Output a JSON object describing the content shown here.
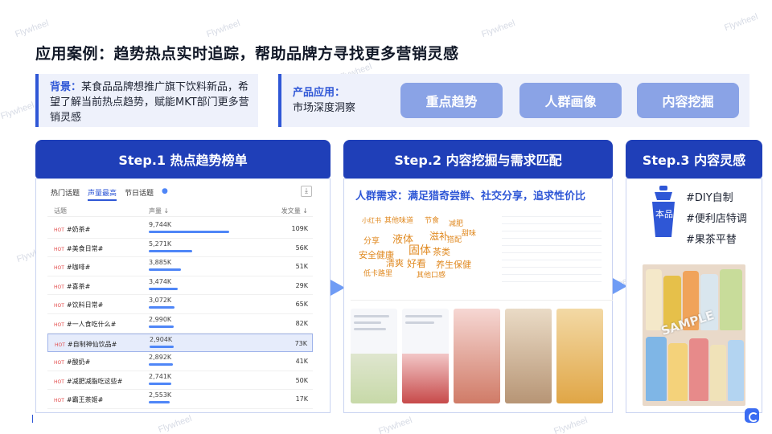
{
  "page": {
    "title": "应用案例：趋势热点实时追踪，帮助品牌方寻找更多营销灵感",
    "watermark": "Flywheel"
  },
  "background": {
    "label": "背景：",
    "text": "某食品品牌想推广旗下饮料新品，希望了解当前热点趋势，赋能MKT部门更多营销灵感"
  },
  "product": {
    "label": "产品应用：",
    "label2": "市场深度洞察",
    "pills": [
      "重点趋势",
      "人群画像",
      "内容挖掘"
    ]
  },
  "steps": [
    "Step.1 热点趋势榜单",
    "Step.2 内容挖掘与需求匹配",
    "Step.3 内容灵感"
  ],
  "trend_table": {
    "tabs": [
      "热门话题",
      "声量最高",
      "节日话题"
    ],
    "active_tab": 1,
    "columns": [
      "话题",
      "声量 ↓",
      "发文量 ↓"
    ],
    "rows": [
      {
        "topic": "#奶茶#",
        "volume": "9,744K",
        "posts": "109K",
        "share": 1.0
      },
      {
        "topic": "#美食日常#",
        "volume": "5,271K",
        "posts": "56K",
        "share": 0.54
      },
      {
        "topic": "#咖啡#",
        "volume": "3,885K",
        "posts": "51K",
        "share": 0.4
      },
      {
        "topic": "#喜茶#",
        "volume": "3,474K",
        "posts": "29K",
        "share": 0.36
      },
      {
        "topic": "#饮料日常#",
        "volume": "3,072K",
        "posts": "65K",
        "share": 0.32
      },
      {
        "topic": "#一人食吃什么#",
        "volume": "2,990K",
        "posts": "82K",
        "share": 0.31
      },
      {
        "topic": "#自制神仙饮品#",
        "volume": "2,904K",
        "posts": "73K",
        "share": 0.3,
        "highlight": true
      },
      {
        "topic": "#酸奶#",
        "volume": "2,892K",
        "posts": "41K",
        "share": 0.3
      },
      {
        "topic": "#减肥减脂吃这些#",
        "volume": "2,741K",
        "posts": "50K",
        "share": 0.28
      },
      {
        "topic": "#霸王茶姬#",
        "volume": "2,553K",
        "posts": "17K",
        "share": 0.26
      }
    ]
  },
  "content_mining": {
    "need": "人群需求：满足猎奇尝鲜、社交分享，追求性价比",
    "cloud_words": [
      "小红书",
      "其他味道",
      "液体",
      "固体",
      "分享",
      "安全健康",
      "好看",
      "茶类",
      "养生保健",
      "滋补",
      "清爽",
      "搭配",
      "节食",
      "减肥",
      "甜味",
      "其他口感",
      "低卡路里"
    ]
  },
  "inspiration": {
    "shaker_label": "本品",
    "tags": [
      "#DIY自制",
      "#便利店特调",
      "#果茶平替"
    ],
    "sample": "SAMPLE"
  }
}
